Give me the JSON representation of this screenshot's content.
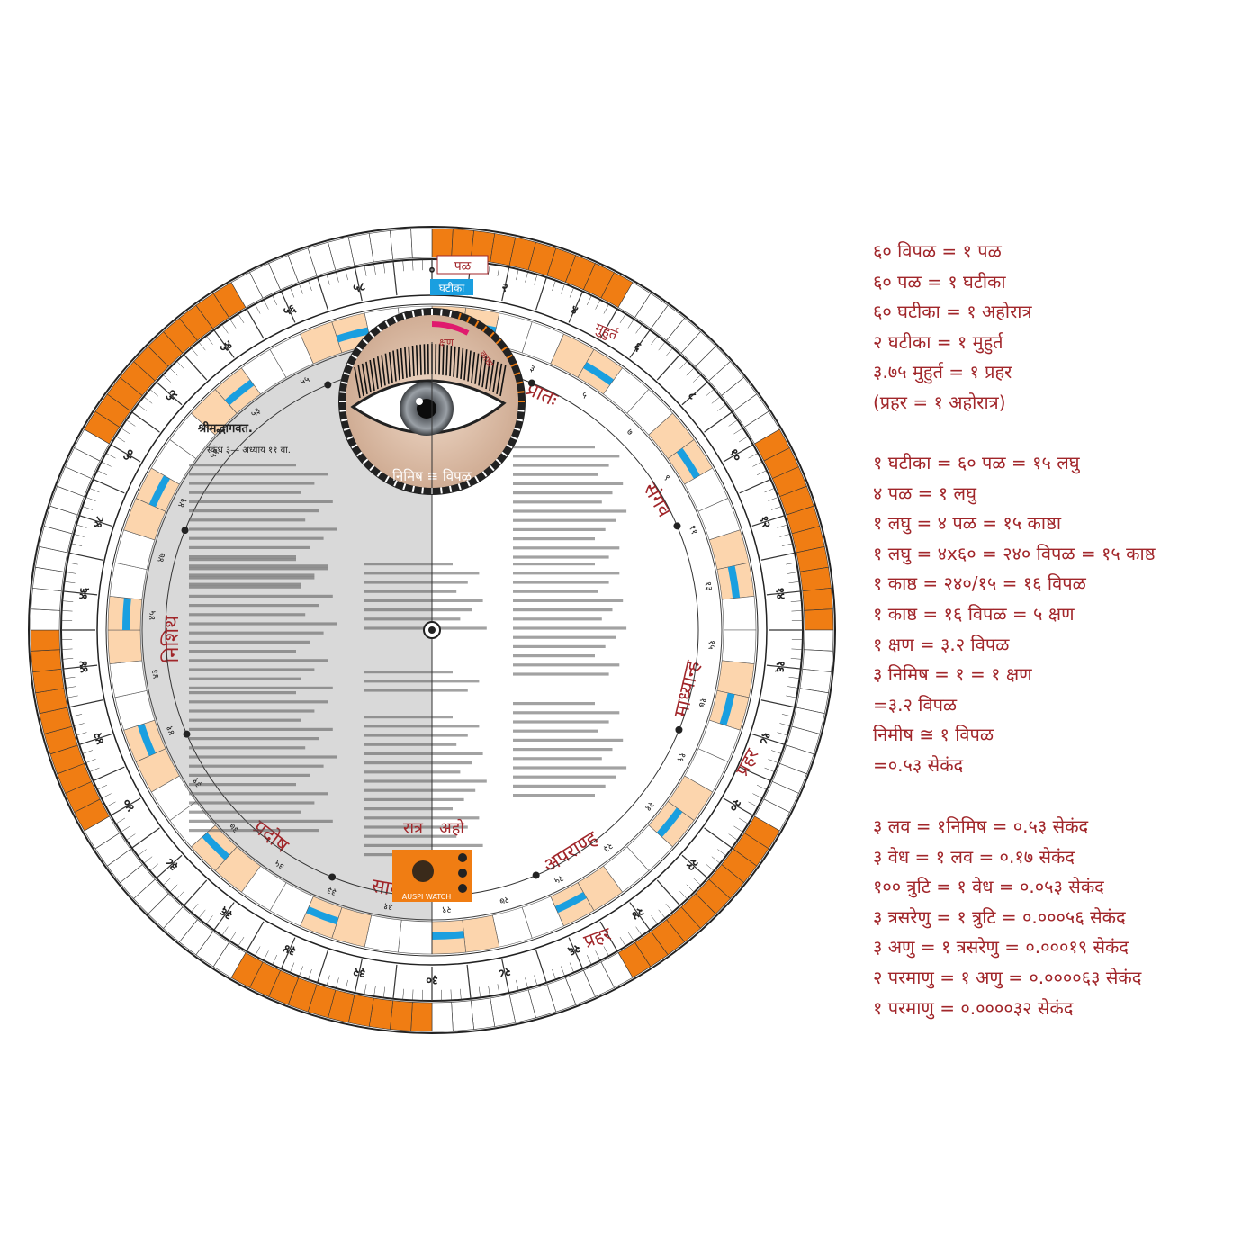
{
  "colors": {
    "accent": "#a1262a",
    "orange": "#f07d13",
    "peach": "#fcd5ad",
    "blue": "#1a9fe0",
    "gray": "#d9d9d9",
    "ink": "#222222"
  },
  "dial": {
    "outer_label_top": "पळ",
    "inner_label_top": "घटीका",
    "outer_numbers": [
      "०",
      "२",
      "४",
      "६",
      "८",
      "१०",
      "१२",
      "१४",
      "१६",
      "१८",
      "२०",
      "२२",
      "२४",
      "२६",
      "२८",
      "३०",
      "३२",
      "३४",
      "३६",
      "३८",
      "४०",
      "४२",
      "४४",
      "४६",
      "४८",
      "५०",
      "५२",
      "५४",
      "५६",
      "५८"
    ],
    "inner_numbers": [
      "१",
      "३",
      "५",
      "७",
      "९",
      "११",
      "१३",
      "१५",
      "१७",
      "१९",
      "२१",
      "२३",
      "२५",
      "२७",
      "२९",
      "३१",
      "३३",
      "३५",
      "३७",
      "३९",
      "४१",
      "४३",
      "४५",
      "४७",
      "४९",
      "५१",
      "५३",
      "५५",
      "५७",
      "५९"
    ],
    "prahar_names": [
      "प्रातः",
      "संगव",
      "माध्यान्ह",
      "अपराण्ह",
      "सायं",
      "प्रदोष",
      "निशिथ"
    ],
    "prahar_word": "प्रहर",
    "muhurt_word": "मुहुर्त",
    "eye_labels": {
      "kshan": "क्षण",
      "kashtha": "काष्ठा",
      "nimish": "निमिष ≅ विपळ"
    },
    "ratra": "रात्र",
    "aho": "अहो",
    "logo_text": "AUSPI WATCH",
    "text_title": "श्रीमद्भागवत.",
    "text_subtitle": "स्कंध ३— अध्याय ११ वा."
  },
  "equations_group1": [
    "६० विपळ = १ पळ",
    "६० पळ = १ घटीका",
    "६० घटीका = १ अहोरात्र",
    "२ घटीका = १ मुहुर्त",
    "३.७५ मुहुर्त = १ प्रहर",
    "(प्रहर = १ अहोरात्र)"
  ],
  "equations_group2": [
    "१ घटीका = ६० पळ = १५ लघु",
    "४ पळ = १ लघु",
    "१ लघु = ४ पळ = १५ काष्ठा",
    "१ लघु = ४x६० = २४० विपळ = १५ काष्ठ",
    "१ काष्ठ = २४०/१५ = १६ विपळ",
    "१ काष्ठ = १६ विपळ = ५ क्षण",
    "१ क्षण = ३.२ विपळ",
    "३ निमिष = १ = १ क्षण",
    "=३.२ विपळ",
    "निमीष ≅ १ विपळ",
    "=०.५३ सेकंद"
  ],
  "equations_group3": [
    "३ लव = १निमिष = ०.५३ सेकंद",
    "३ वेध = १ लव = ०.१७ सेकंद",
    "१०० त्रुटि = १ वेध = ०.०५३ सेकंद",
    "३ त्रसरेणु = १ त्रुटि = ०.०००५६ सेकंद",
    "३ अणु = १ त्रसरेणु = ०.०००१९ सेकंद",
    "२ परमाणु = १ अणु = ०.००००६३ सेकंद",
    "१ परमाणु = ०.००००३२ सेकंद"
  ]
}
